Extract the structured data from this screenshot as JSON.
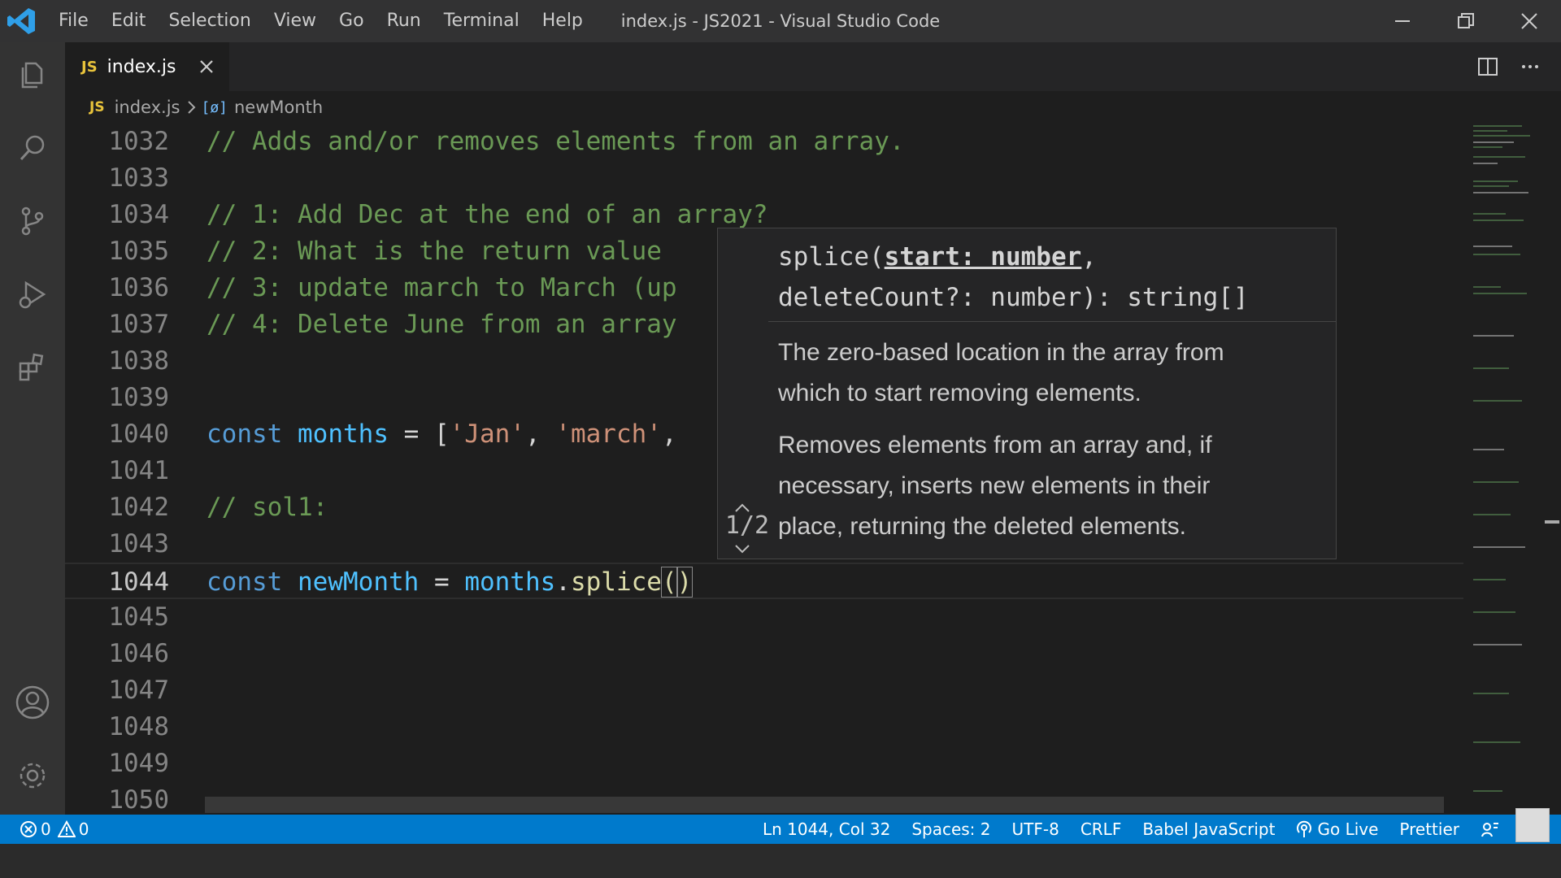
{
  "window": {
    "title": "index.js - JS2021 - Visual Studio Code",
    "menu": [
      "File",
      "Edit",
      "Selection",
      "View",
      "Go",
      "Run",
      "Terminal",
      "Help"
    ]
  },
  "activity_bar": [
    "explorer-icon",
    "search-icon",
    "source-control-icon",
    "run-debug-icon",
    "extensions-icon",
    "accounts-icon",
    "settings-gear-icon"
  ],
  "tab": {
    "badge": "JS",
    "label": "index.js"
  },
  "breadcrumb": {
    "badge": "JS",
    "file": "index.js",
    "symbol": "[ø]",
    "item": "newMonth"
  },
  "editor": {
    "lines": [
      {
        "n": "1032",
        "comment": "// Adds and/or removes elements from an array."
      },
      {
        "n": "1033"
      },
      {
        "n": "1034",
        "comment": "// 1: Add Dec at the end of an array?"
      },
      {
        "n": "1035",
        "comment": "// 2: What is the return value"
      },
      {
        "n": "1036",
        "comment": "// 3: update march to March (up"
      },
      {
        "n": "1037",
        "comment": "// 4: Delete June from an array"
      },
      {
        "n": "1038"
      },
      {
        "n": "1039"
      },
      {
        "n": "1040",
        "kw": "const",
        "var": "months",
        "op": " = [",
        "str1": "'Jan'",
        "sep": ", ",
        "str2": "'march'",
        "tail": ","
      },
      {
        "n": "1041"
      },
      {
        "n": "1042",
        "comment": "// sol1:"
      },
      {
        "n": "1043"
      },
      {
        "n": "1044",
        "kw": "const",
        "var": "newMonth",
        "op": " = ",
        "obj": "months",
        "dot": ".",
        "fn": "splice",
        "open": "(",
        "close": ")"
      },
      {
        "n": "1045"
      },
      {
        "n": "1046"
      },
      {
        "n": "1047"
      },
      {
        "n": "1048"
      },
      {
        "n": "1049"
      },
      {
        "n": "1050"
      }
    ]
  },
  "hover": {
    "nav_count": "1/2",
    "sig_fn": "splice(",
    "sig_param_active": "start: number",
    "sig_comma": ",",
    "sig_line2": "deleteCount?: number): string[]",
    "param_doc_1": "The zero-based location in the array from",
    "param_doc_2": "which to start removing elements.",
    "fn_doc_1": "Removes elements from an array and, if",
    "fn_doc_2": "necessary, inserts new elements in their",
    "fn_doc_3": "place, returning the deleted elements."
  },
  "status": {
    "errors": "0",
    "warnings": "0",
    "position": "Ln 1044, Col 32",
    "spaces": "Spaces: 2",
    "encoding": "UTF-8",
    "eol": "CRLF",
    "language": "Babel JavaScript",
    "golive": "Go Live",
    "formatter": "Prettier"
  },
  "colors": {
    "statusbar": "#007acc",
    "comment": "#6a9955",
    "keyword": "#569cd6",
    "variable": "#4fc1ff",
    "string": "#ce9178",
    "function": "#dcdcaa"
  }
}
